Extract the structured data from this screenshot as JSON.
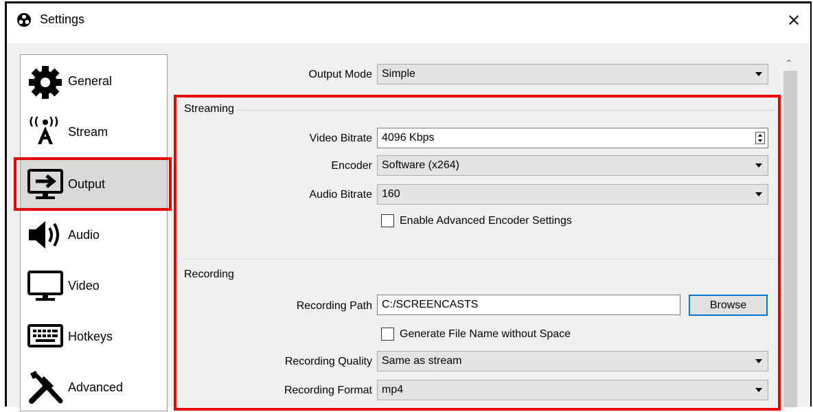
{
  "window": {
    "title": "Settings",
    "close_glyph": "✕"
  },
  "sidebar": {
    "items": [
      {
        "label": "General",
        "icon": "gear-icon"
      },
      {
        "label": "Stream",
        "icon": "antenna-icon"
      },
      {
        "label": "Output",
        "icon": "output-monitor-icon",
        "active": true
      },
      {
        "label": "Audio",
        "icon": "speaker-icon"
      },
      {
        "label": "Video",
        "icon": "monitor-icon"
      },
      {
        "label": "Hotkeys",
        "icon": "keyboard-icon"
      },
      {
        "label": "Advanced",
        "icon": "tools-icon"
      }
    ]
  },
  "output": {
    "mode_label": "Output Mode",
    "mode_value": "Simple",
    "streaming": {
      "title": "Streaming",
      "video_bitrate_label": "Video Bitrate",
      "video_bitrate_value": "4096 Kbps",
      "encoder_label": "Encoder",
      "encoder_value": "Software (x264)",
      "audio_bitrate_label": "Audio Bitrate",
      "audio_bitrate_value": "160",
      "advanced_encoder_label": "Enable Advanced Encoder Settings",
      "advanced_encoder_checked": false
    },
    "recording": {
      "title": "Recording",
      "path_label": "Recording Path",
      "path_value": "C:/SCREENCASTS",
      "browse_label": "Browse",
      "filename_nospace_label": "Generate File Name without Space",
      "filename_nospace_checked": false,
      "quality_label": "Recording Quality",
      "quality_value": "Same as stream",
      "format_label": "Recording Format",
      "format_value": "mp4"
    }
  },
  "colors": {
    "highlight": "#e60000",
    "accent": "#0078d7",
    "panel_bg": "#f0f0f0"
  }
}
